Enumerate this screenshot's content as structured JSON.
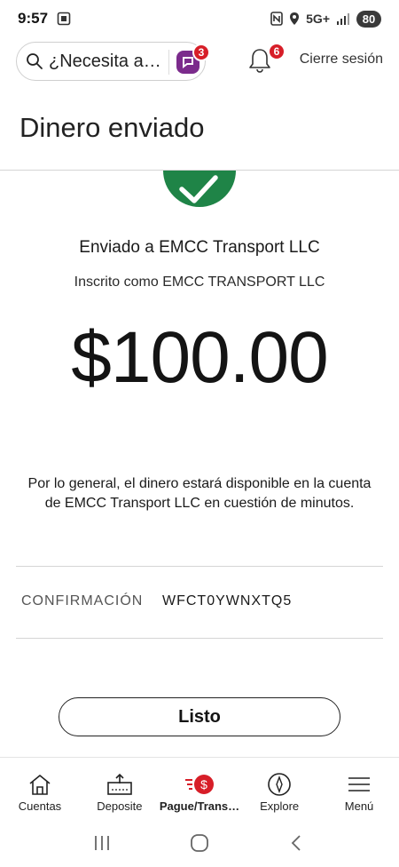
{
  "status_bar": {
    "time": "9:57",
    "network": "5G+",
    "battery": "80"
  },
  "header": {
    "search_placeholder": "¿Necesita a…",
    "assist_badge": "3",
    "notifications_badge": "6",
    "logout_label": "Cierre sesión"
  },
  "page": {
    "title": "Dinero enviado"
  },
  "confirmation": {
    "sent_to": "Enviado a EMCC Transport LLC",
    "enrolled_as": "Inscrito como EMCC TRANSPORT LLC",
    "amount": "$100.00",
    "info": "Por lo general, el dinero estará disponible en la cuenta de EMCC Transport LLC en cuestión de minutos.",
    "label": "CONFIRMACIÓN",
    "code": "WFCT0YWNXTQ5"
  },
  "done_label": "Listo",
  "bottom_nav": [
    {
      "label": "Cuentas",
      "icon": "home-icon"
    },
    {
      "label": "Deposite",
      "icon": "deposit-icon"
    },
    {
      "label": "Pague/Trans…",
      "icon": "pay-transfer-icon"
    },
    {
      "label": "Explore",
      "icon": "compass-icon"
    },
    {
      "label": "Menú",
      "icon": "menu-icon"
    }
  ],
  "colors": {
    "success": "#1f8447",
    "brand_red": "#d71e28",
    "assist": "#7b2b8c"
  }
}
